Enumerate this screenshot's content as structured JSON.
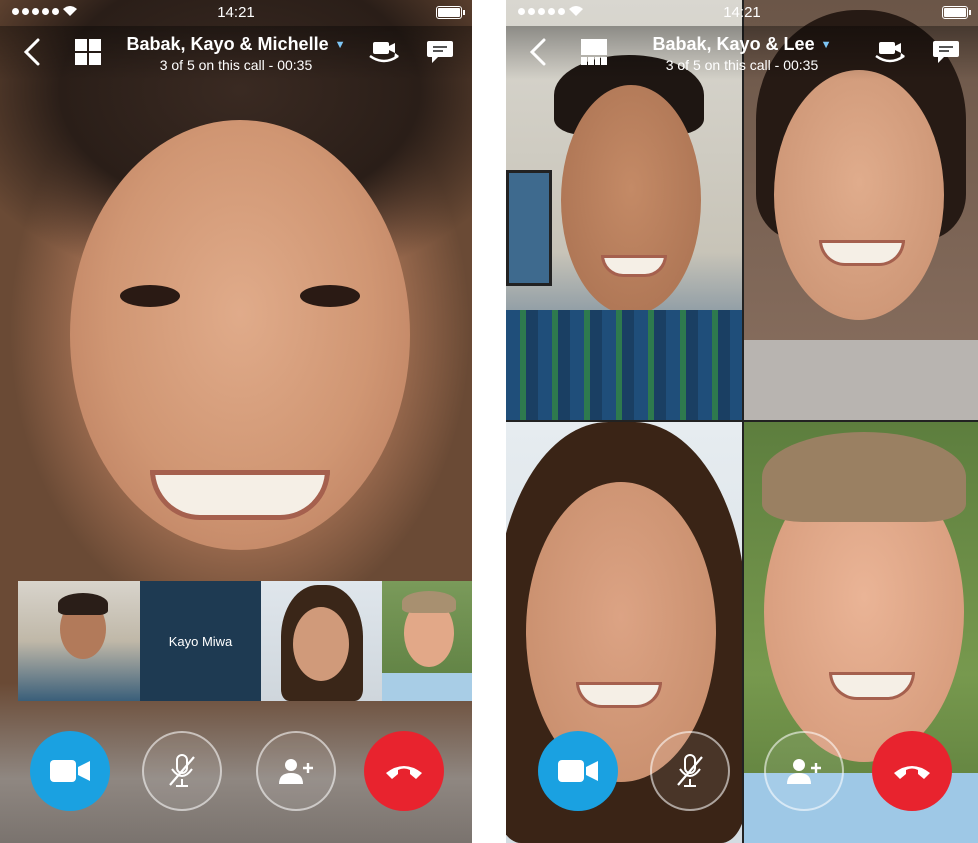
{
  "left_screen": {
    "status": {
      "time": "14:21"
    },
    "header": {
      "title": "Babak, Kayo & Michelle",
      "subtitle": "3 of 5 on this call - 00:35"
    },
    "thumbnails": [
      {
        "kind": "video",
        "label": ""
      },
      {
        "kind": "name",
        "label": "Kayo Miwa"
      },
      {
        "kind": "video",
        "label": ""
      },
      {
        "kind": "video",
        "label": ""
      }
    ]
  },
  "right_screen": {
    "status": {
      "time": "14:21"
    },
    "header": {
      "title": "Babak, Kayo & Lee",
      "subtitle": "3 of 5 on this call - 00:35"
    }
  },
  "icons": {
    "back": "back-chevron-icon",
    "layout_grid": "grid-layout-icon",
    "layout_single": "single-layout-icon",
    "switch_camera": "switch-camera-icon",
    "chat": "chat-bubble-icon",
    "video": "video-camera-icon",
    "mute": "microphone-muted-icon",
    "add_person": "add-person-icon",
    "end_call": "end-call-icon"
  },
  "colors": {
    "video_button": "#1aa1e1",
    "end_call_button": "#e8232e",
    "name_tile": "#1e3a52",
    "dropdown_chevron": "#7ec6f5"
  }
}
